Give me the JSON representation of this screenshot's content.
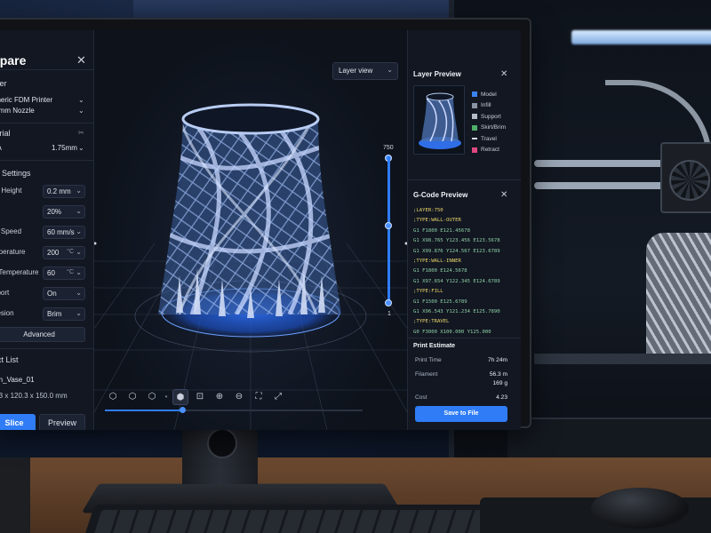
{
  "left_panel": {
    "title": "epare",
    "close_icon": "close-icon",
    "printer_section": "nter",
    "printer_name": "eneric FDM Printer",
    "nozzle": ".4mm Nozzle",
    "material_section": "terial",
    "material": "LA",
    "filament_diameter": "1.75mm",
    "print_settings_section": "nt Settings",
    "settings": [
      {
        "label": "er Height",
        "value": "0.2 mm",
        "unit": ""
      },
      {
        "label": "ll",
        "value": "20%",
        "unit": ""
      },
      {
        "label": "nt Speed",
        "value": "60 mm/s",
        "unit": ""
      },
      {
        "label": "mperature",
        "value": "200",
        "unit": "°C"
      },
      {
        "label": "d Temperature",
        "value": "60",
        "unit": "°C"
      },
      {
        "label": "pport",
        "value": "On",
        "unit": ""
      },
      {
        "label": "hesion",
        "value": "Brim",
        "unit": ""
      }
    ],
    "advanced_label": "Advanced",
    "object_list_section": "ect List",
    "object_name": "ath_Vase_01",
    "object_dims": "0.3 x 120.3 x 150.0 mm",
    "slice_label": "Slice",
    "preview_label": "Preview"
  },
  "viewport": {
    "view_mode": "Layer view",
    "layer_max": "750",
    "layer_min": "1",
    "playback_progress": 0.3,
    "toolbar_icons": [
      "cube-front-icon",
      "cube-iso-icon",
      "cube-side-icon",
      "separator",
      "cube-selected-icon",
      "zoom-fit-icon",
      "zoom-in-icon",
      "zoom-out-icon",
      "fit-frame-icon",
      "fullscreen-icon"
    ]
  },
  "layer_preview": {
    "title": "Layer Preview",
    "legend": [
      {
        "label": "Model",
        "color": "#3b82f6",
        "kind": "box"
      },
      {
        "label": "Infill",
        "color": "#8a93a3",
        "kind": "box"
      },
      {
        "label": "Support",
        "color": "#b5bcc8",
        "kind": "box"
      },
      {
        "label": "Skirt/Brim",
        "color": "#4fae6a",
        "kind": "box"
      },
      {
        "label": "Travel",
        "color": "#d5dae3",
        "kind": "line"
      },
      {
        "label": "Retract",
        "color": "#e0487f",
        "kind": "box"
      }
    ]
  },
  "gcode_preview": {
    "title": "G-Code Preview",
    "lines": [
      {
        "text": ";LAYER:750",
        "color": "#e9d56a"
      },
      {
        "text": ";TYPE:WALL-OUTER",
        "color": "#e9d56a"
      },
      {
        "text": "G1 F1800 E121.45678",
        "color": "#8fd0a4"
      },
      {
        "text": "G1 X98.765 Y123.456 E123.5678",
        "color": "#8fd0a4"
      },
      {
        "text": "G1 X99.876 Y124.567 E123.6789",
        "color": "#8fd0a4"
      },
      {
        "text": ";TYPE:WALL-INNER",
        "color": "#e9d56a"
      },
      {
        "text": "G1 F1800 E124.5678",
        "color": "#8fd0a4"
      },
      {
        "text": "G1 X97.654 Y122.345 E124.6789",
        "color": "#8fd0a4"
      },
      {
        "text": ";TYPE:FILL",
        "color": "#e9d56a"
      },
      {
        "text": "G1 F1500 E125.6789",
        "color": "#8fd0a4"
      },
      {
        "text": "G1 X96.543 Y121.234 E125.7890",
        "color": "#8fd0a4"
      },
      {
        "text": ";TYPE:TRAVEL",
        "color": "#e9d56a"
      },
      {
        "text": "G0 F3000 X100.000 Y125.000",
        "color": "#8fd0a4"
      }
    ]
  },
  "print_estimate": {
    "title": "Print Estimate",
    "print_time_label": "Print Time",
    "print_time": "7h 24m",
    "filament_label": "Filament",
    "filament_length": "56.3 m",
    "filament_weight": "169 g",
    "cost_label": "Cost",
    "cost": "4.23",
    "save_label": "Save to File"
  }
}
